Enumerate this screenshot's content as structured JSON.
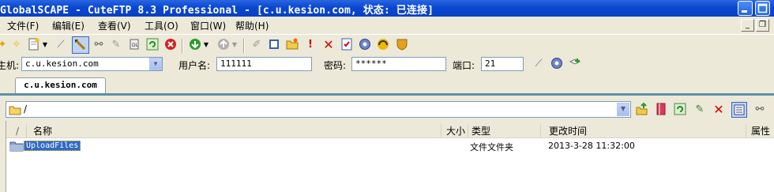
{
  "titlebar": {
    "title": "GlobalSCAPE - CuteFTP 8.3 Professional - [c.u.kesion.com, 状态: 已连接]"
  },
  "menubar": {
    "items": [
      "文件(F)",
      "编辑(E)",
      "查看(V)",
      "工具(O)",
      "窗口(W)",
      "帮助(H)"
    ]
  },
  "quickconnect": {
    "host_label": "主机:",
    "host_value": "c.u.kesion.com",
    "user_label": "用户名:",
    "user_value": "111111",
    "pass_label": "密码:",
    "pass_value": "******",
    "port_label": "端口:",
    "port_value": "21"
  },
  "tabs": [
    {
      "label": "c.u.kesion.com"
    }
  ],
  "pathbar": {
    "path": "/"
  },
  "filelist": {
    "columns": [
      "/",
      "名称",
      "大小",
      "类型",
      "更改时间",
      "属性"
    ],
    "rows": [
      {
        "name": "UploadFiles",
        "size": "",
        "type": "文件文件夹",
        "modified": "2013-3-28 11:32:00",
        "attributes": ""
      }
    ]
  },
  "colors": {
    "titlebar": "#0a47d1",
    "tab_underline": "#5d8fa7",
    "selection": "#316ac5"
  }
}
